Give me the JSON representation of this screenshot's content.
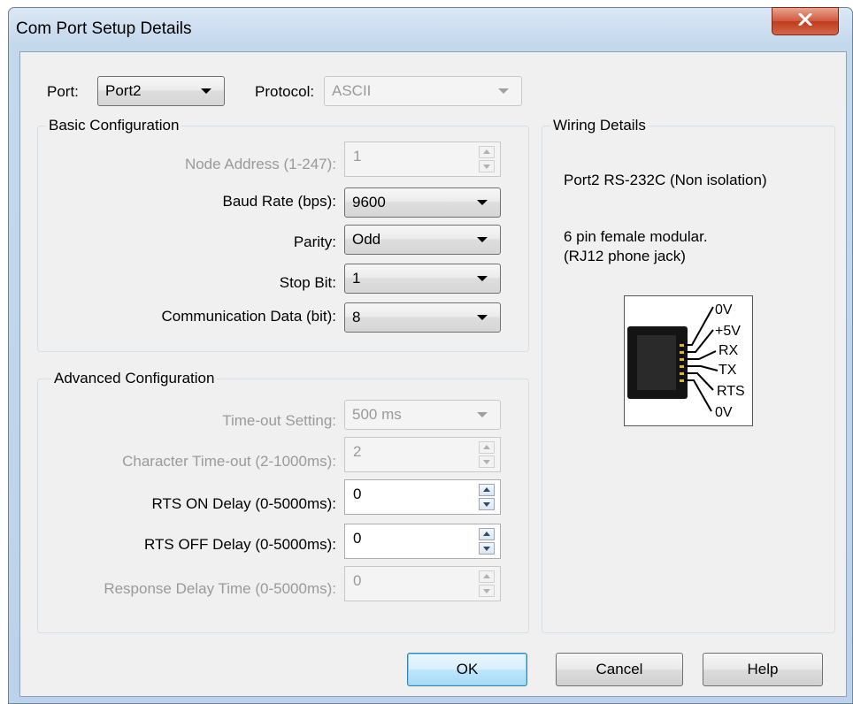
{
  "window": {
    "title": "Com Port Setup Details",
    "close_symbol": "x"
  },
  "top": {
    "port_label": "Port:",
    "port_value": "Port2",
    "protocol_label": "Protocol:",
    "protocol_value": "ASCII"
  },
  "basic": {
    "title": "Basic Configuration",
    "node_address_label": "Node Address (1-247):",
    "node_address_value": "1",
    "baud_label": "Baud Rate (bps):",
    "baud_value": "9600",
    "parity_label": "Parity:",
    "parity_value": "Odd",
    "stop_bit_label": "Stop Bit:",
    "stop_bit_value": "1",
    "data_bits_label": "Communication Data (bit):",
    "data_bits_value": "8"
  },
  "advanced": {
    "title": "Advanced Configuration",
    "timeout_label": "Time-out Setting:",
    "timeout_value": "500 ms",
    "char_timeout_label": "Character Time-out (2-1000ms):",
    "char_timeout_value": "2",
    "rts_on_label": "RTS ON Delay (0-5000ms):",
    "rts_on_value": "0",
    "rts_off_label": "RTS OFF Delay (0-5000ms):",
    "rts_off_value": "0",
    "response_delay_label": "Response Delay Time (0-5000ms):",
    "response_delay_value": "0"
  },
  "wiring": {
    "title": "Wiring Details",
    "port_desc": "Port2 RS-232C (Non isolation)",
    "connector_line1": "6 pin female modular.",
    "connector_line2": "(RJ12 phone jack)",
    "pins": [
      "0V",
      "+5V",
      "RX",
      "TX",
      "RTS",
      "0V"
    ]
  },
  "buttons": {
    "ok": "OK",
    "cancel": "Cancel",
    "help": "Help"
  },
  "colors": {
    "disabled_text": "#9a9a9a",
    "close_button": "#c13b1d",
    "default_button_border": "#3c7fb1"
  }
}
